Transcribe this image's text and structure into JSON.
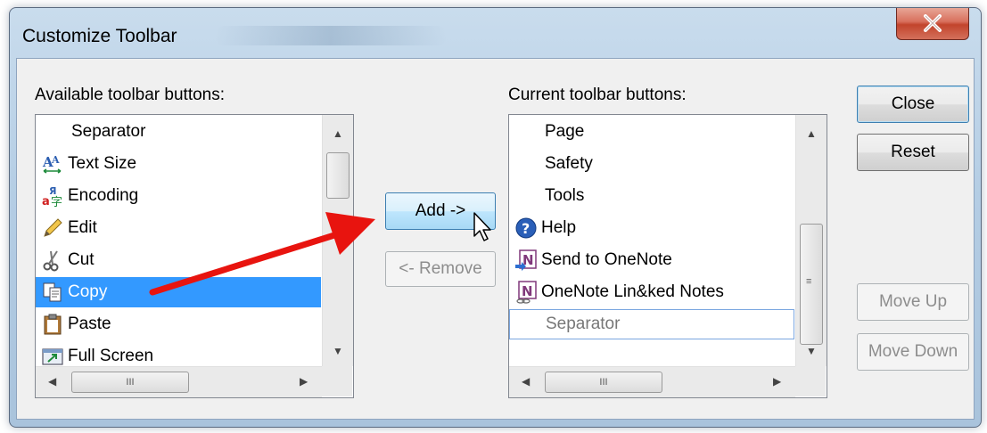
{
  "window": {
    "title": "Customize Toolbar",
    "close_glyph": "X"
  },
  "available": {
    "label": "Available toolbar buttons:",
    "items": [
      {
        "label": "Separator",
        "icon": "none"
      },
      {
        "label": "Text Size",
        "icon": "text-size-icon"
      },
      {
        "label": "Encoding",
        "icon": "encoding-icon"
      },
      {
        "label": "Edit",
        "icon": "pencil-icon"
      },
      {
        "label": "Cut",
        "icon": "scissors-icon"
      },
      {
        "label": "Copy",
        "icon": "copy-icon",
        "selected": true
      },
      {
        "label": "Paste",
        "icon": "clipboard-icon"
      },
      {
        "label": "Full Screen",
        "icon": "full-screen-icon"
      }
    ],
    "scroll_glyph": "III"
  },
  "current": {
    "label": "Current toolbar buttons:",
    "items": [
      {
        "label": "Page",
        "icon": "none"
      },
      {
        "label": "Safety",
        "icon": "none"
      },
      {
        "label": "Tools",
        "icon": "none"
      },
      {
        "label": "Help",
        "icon": "help-icon"
      },
      {
        "label": "Send to OneNote",
        "icon": "onenote-send-icon"
      },
      {
        "label": "OneNote Lin&ked Notes",
        "icon": "onenote-linked-icon"
      },
      {
        "label": "Separator",
        "icon": "none",
        "focused": true
      }
    ],
    "scroll_glyph": "III"
  },
  "buttons": {
    "add": "Add ->",
    "remove": "<- Remove",
    "close": "Close",
    "reset": "Reset",
    "move_up": "Move Up",
    "move_down": "Move Down"
  },
  "colors": {
    "selection": "#3399ff",
    "arrow": "#e8140f"
  }
}
